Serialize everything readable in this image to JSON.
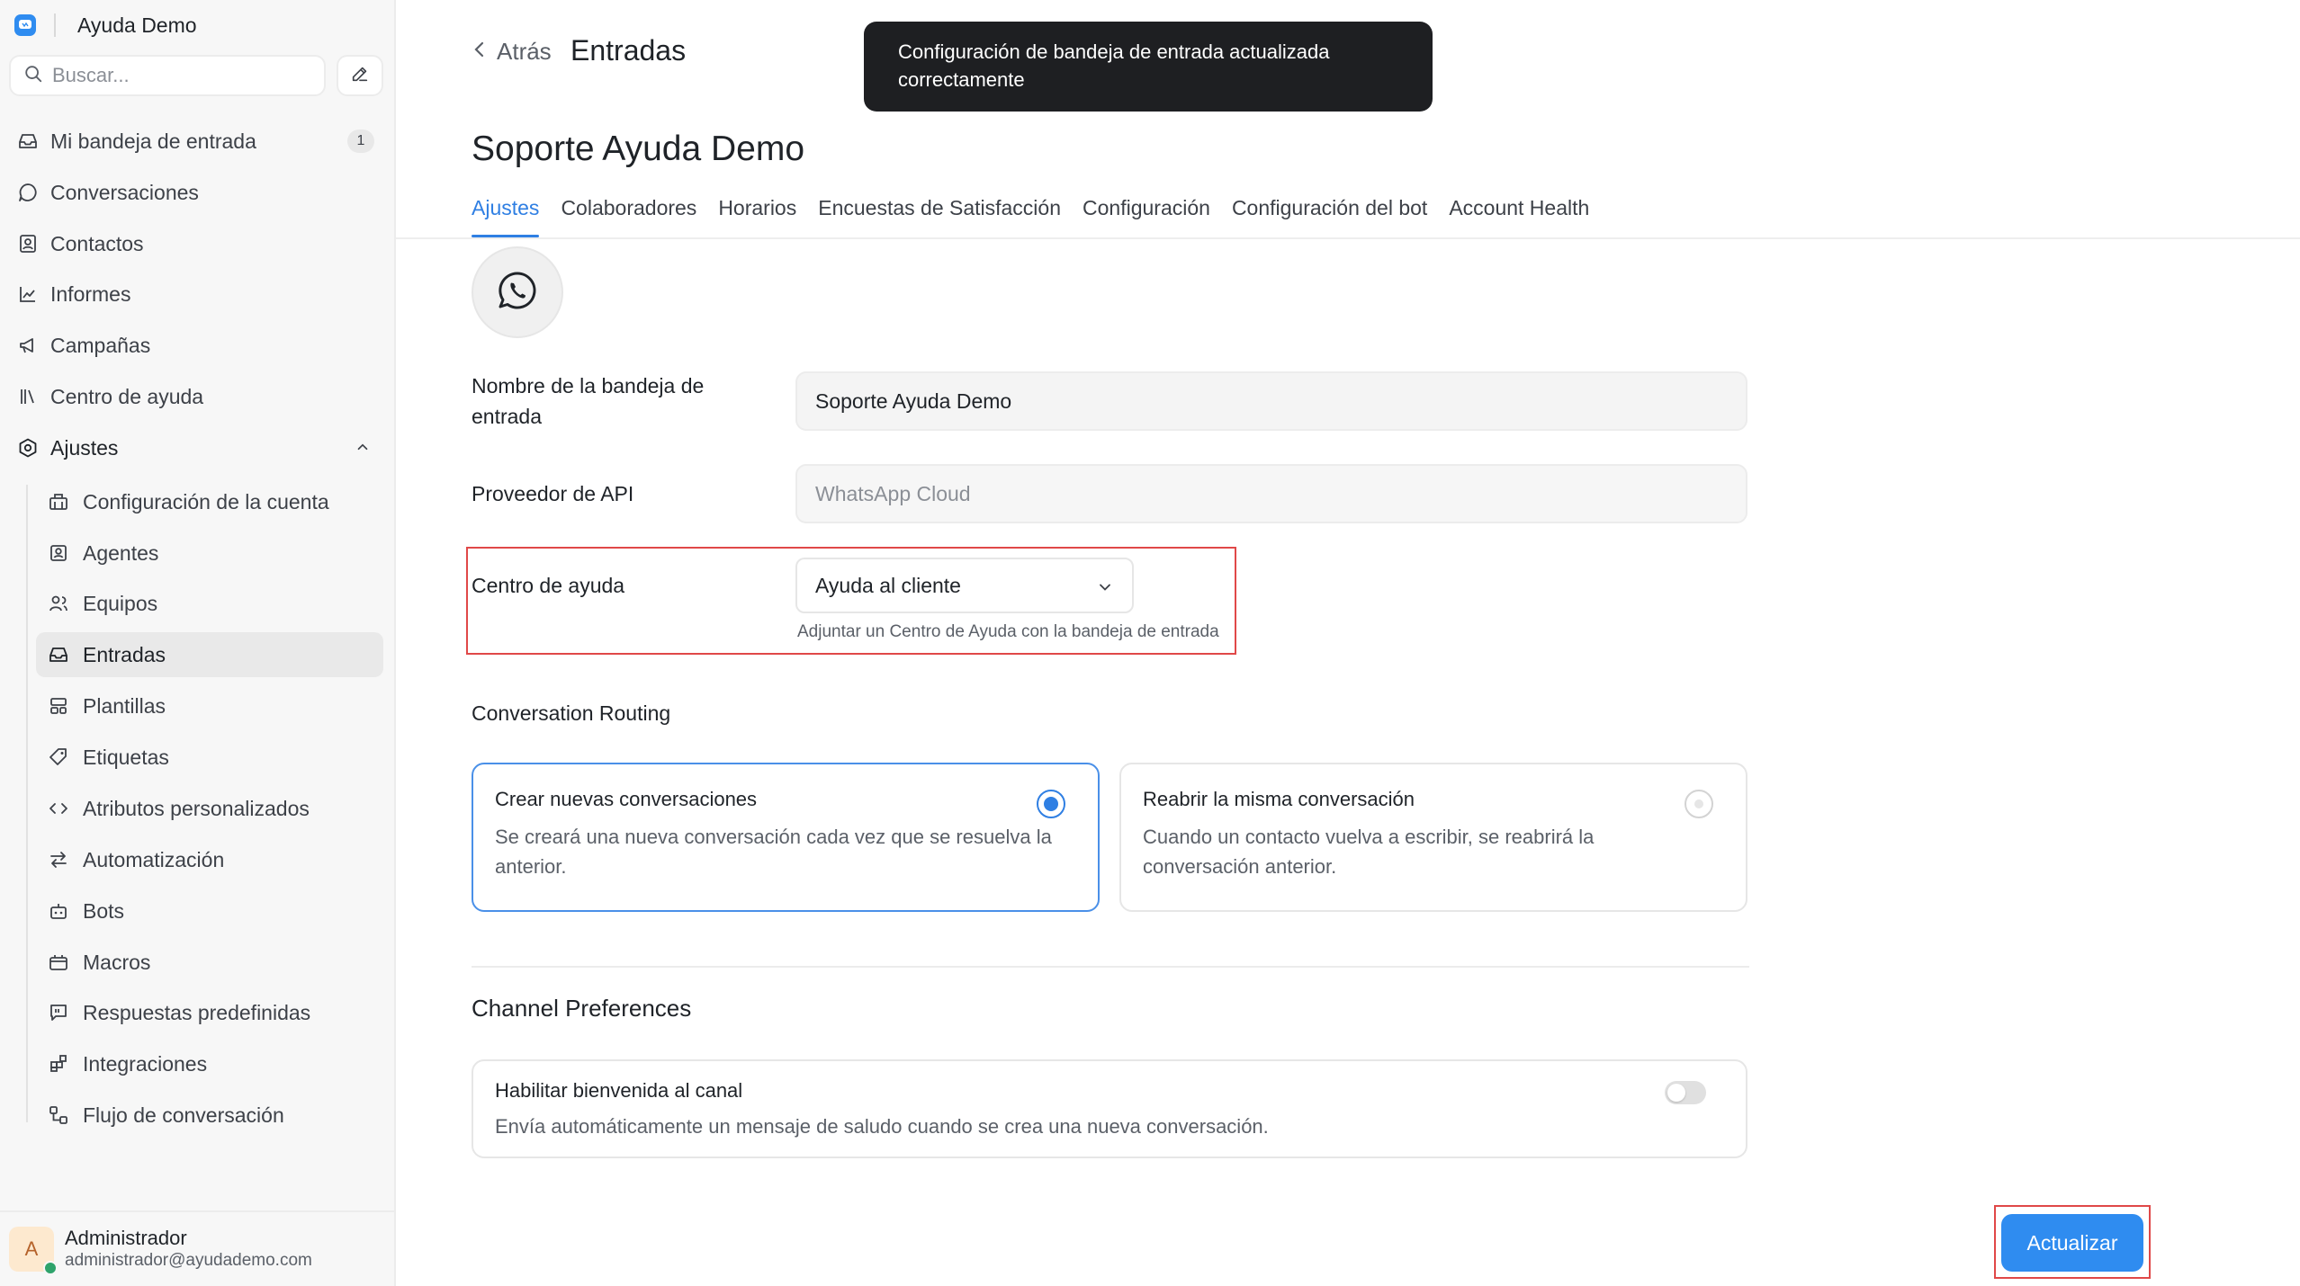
{
  "colors": {
    "accent": "#2f7fe3",
    "button": "#2f8cf0",
    "highlight": "#e04848",
    "toast_bg": "#1e1f22",
    "status_online": "#2ea36b"
  },
  "sidebar": {
    "brand": {
      "name": "Ayuda Demo",
      "logo_icon": "chat-logo-icon"
    },
    "search": {
      "placeholder": "Buscar...",
      "value": ""
    },
    "compose_icon": "pencil-icon",
    "items": [
      {
        "label": "Mi bandeja de entrada",
        "icon": "inbox-icon",
        "badge": "1"
      },
      {
        "label": "Conversaciones",
        "icon": "chat-bubble-icon"
      },
      {
        "label": "Contactos",
        "icon": "contact-card-icon"
      },
      {
        "label": "Informes",
        "icon": "line-chart-icon"
      },
      {
        "label": "Campañas",
        "icon": "megaphone-icon"
      },
      {
        "label": "Centro de ayuda",
        "icon": "library-icon"
      },
      {
        "label": "Ajustes",
        "icon": "settings-hex-icon",
        "expanded": true
      }
    ],
    "settings_items": [
      {
        "label": "Configuración de la cuenta",
        "icon": "building-icon"
      },
      {
        "label": "Agentes",
        "icon": "agent-card-icon"
      },
      {
        "label": "Equipos",
        "icon": "users-icon"
      },
      {
        "label": "Entradas",
        "icon": "inbox-icon",
        "active": true
      },
      {
        "label": "Plantillas",
        "icon": "template-icon"
      },
      {
        "label": "Etiquetas",
        "icon": "tag-icon"
      },
      {
        "label": "Atributos personalizados",
        "icon": "code-icon"
      },
      {
        "label": "Automatización",
        "icon": "arrows-swap-icon"
      },
      {
        "label": "Bots",
        "icon": "bot-icon"
      },
      {
        "label": "Macros",
        "icon": "briefcase-icon"
      },
      {
        "label": "Respuestas predefinidas",
        "icon": "canned-reply-icon"
      },
      {
        "label": "Integraciones",
        "icon": "puzzle-grid-icon"
      },
      {
        "label": "Flujo de conversación",
        "icon": "flow-icon"
      }
    ],
    "profile": {
      "initial": "A",
      "name": "Administrador",
      "email": "administrador@ayudademo.com"
    }
  },
  "header": {
    "back_label": "Atrás",
    "title": "Entradas"
  },
  "toast": {
    "message": "Configuración de bandeja de entrada actualizada correctamente"
  },
  "inbox": {
    "name_title": "Soporte Ayuda Demo",
    "channel_icon": "whatsapp-icon"
  },
  "tabs": [
    {
      "label": "Ajustes",
      "active": true
    },
    {
      "label": "Colaboradores"
    },
    {
      "label": "Horarios"
    },
    {
      "label": "Encuestas de Satisfacción"
    },
    {
      "label": "Configuración"
    },
    {
      "label": "Configuración del bot"
    },
    {
      "label": "Account Health"
    }
  ],
  "form": {
    "inbox_name_label": "Nombre de la bandeja de entrada",
    "inbox_name_value": "Soporte Ayuda Demo",
    "api_provider_label": "Proveedor de API",
    "api_provider_value": "WhatsApp Cloud",
    "help_center_label": "Centro de ayuda",
    "help_center_value": "Ayuda al cliente",
    "help_center_hint": "Adjuntar un Centro de Ayuda con la bandeja de entrada"
  },
  "routing": {
    "title": "Conversation Routing",
    "options": [
      {
        "title": "Crear nuevas conversaciones",
        "description": "Se creará una nueva conversación cada vez que se resuelva la anterior.",
        "selected": true
      },
      {
        "title": "Reabrir la misma conversación",
        "description": "Cuando un contacto vuelva a escribir, se reabrirá la conversación anterior.",
        "selected": false
      }
    ]
  },
  "channel_preferences": {
    "title": "Channel Preferences",
    "welcome": {
      "title": "Habilitar bienvenida al canal",
      "description": "Envía automáticamente un mensaje de saludo cuando se crea una nueva conversación.",
      "enabled": false
    }
  },
  "actions": {
    "update_label": "Actualizar"
  }
}
